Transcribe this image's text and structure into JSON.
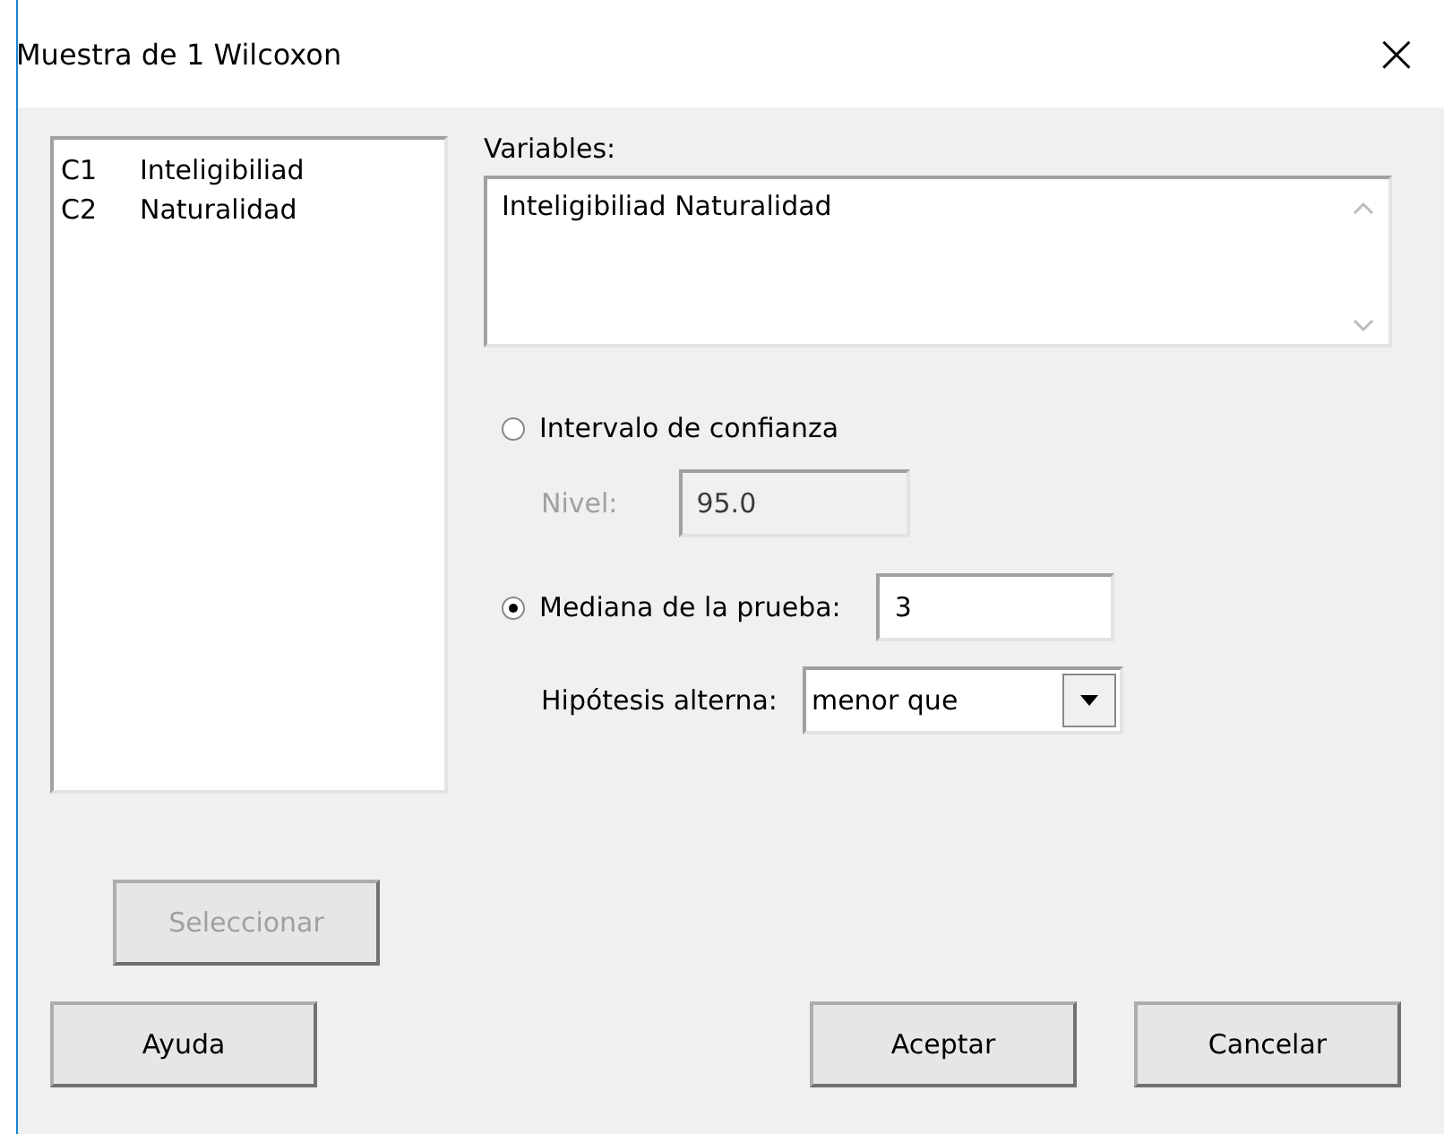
{
  "window": {
    "title": "Muestra de 1 Wilcoxon",
    "close": "×"
  },
  "columns": [
    {
      "id": "C1",
      "name": "Inteligibiliad"
    },
    {
      "id": "C2",
      "name": "Naturalidad"
    }
  ],
  "variables": {
    "label": "Variables:",
    "value": "Inteligibiliad Naturalidad"
  },
  "options": [
    {
      "kind": "level",
      "label": "Intervalo de confianza",
      "selected": false,
      "field_label": "Nivel:",
      "value": "95.0",
      "disabled": true
    },
    {
      "kind": "median",
      "label": "Mediana de la prueba:",
      "selected": true,
      "value": "3",
      "disabled": false
    }
  ],
  "alternative": {
    "label": "Hipótesis alterna:",
    "value": "menor que"
  },
  "buttons": [
    {
      "kind": "select",
      "label": "Seleccionar",
      "disabled": true
    },
    {
      "kind": "help",
      "label": "Ayuda",
      "disabled": false
    },
    {
      "kind": "ok",
      "label": "Aceptar",
      "disabled": false
    },
    {
      "kind": "cancel",
      "label": "Cancelar",
      "disabled": false
    }
  ]
}
